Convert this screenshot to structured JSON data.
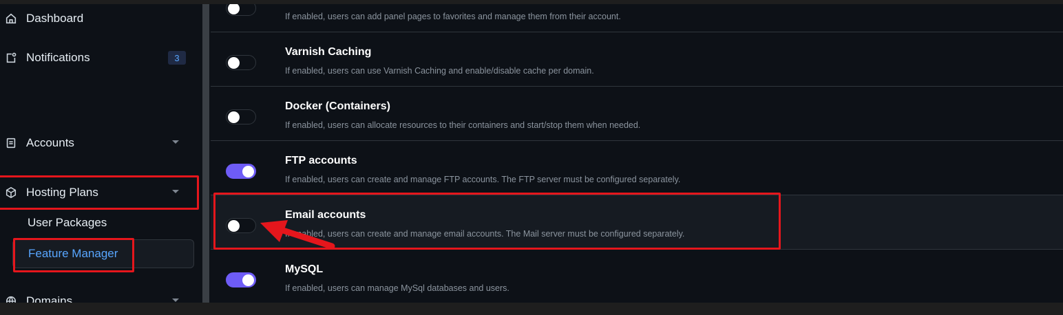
{
  "sidebar": {
    "dashboard": "Dashboard",
    "notifications": "Notifications",
    "notifications_count": "3",
    "accounts": "Accounts",
    "hosting_plans": "Hosting Plans",
    "user_packages": "User Packages",
    "feature_manager": "Feature Manager",
    "domains": "Domains"
  },
  "features": [
    {
      "title": "",
      "description": "If enabled, users can add panel pages to favorites and manage them from their account.",
      "enabled": false
    },
    {
      "title": "Varnish Caching",
      "description": "If enabled, users can use Varnish Caching and enable/disable cache per domain.",
      "enabled": false
    },
    {
      "title": "Docker (Containers)",
      "description": "If enabled, users can allocate resources to their containers and start/stop them when needed.",
      "enabled": false
    },
    {
      "title": "FTP accounts",
      "description": "If enabled, users can create and manage FTP accounts. The FTP server must be configured separately.",
      "enabled": true
    },
    {
      "title": "Email accounts",
      "description": "If enabled, users can create and manage email accounts. The Mail server must be configured separately.",
      "enabled": false
    },
    {
      "title": "MySQL",
      "description": "If enabled, users can manage MySql databases and users.",
      "enabled": true
    }
  ],
  "colors": {
    "accent": "#6e5cf6",
    "highlight": "#e5161c",
    "link": "#58a6ff"
  }
}
